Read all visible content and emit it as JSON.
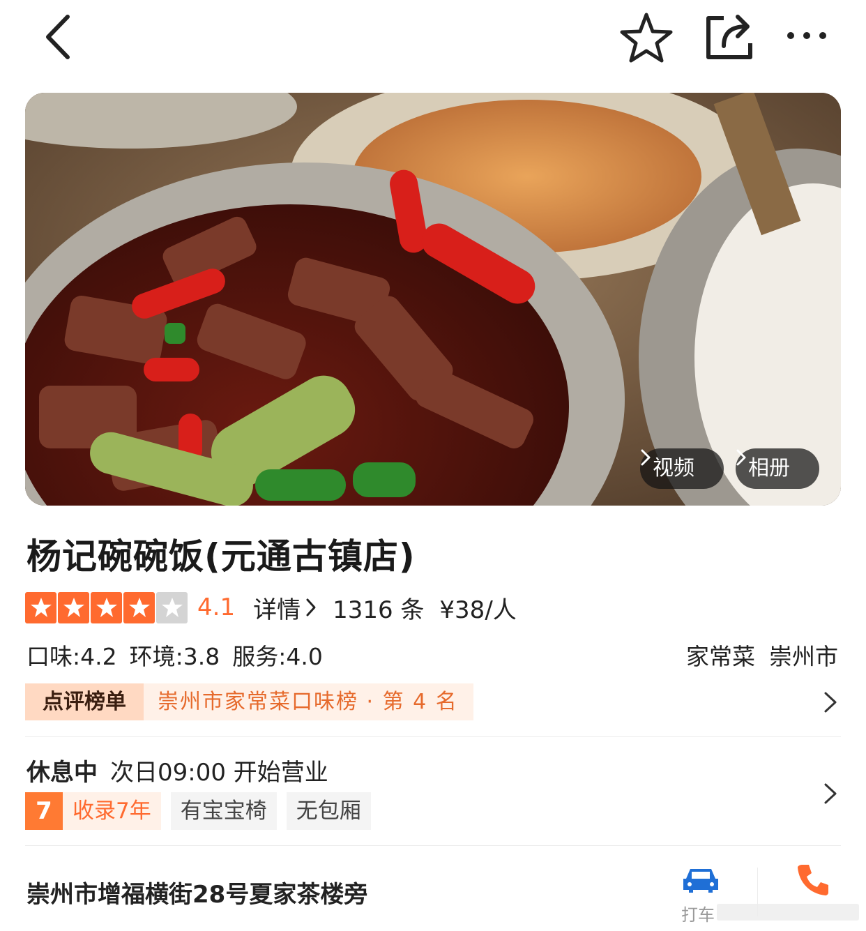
{
  "hero": {
    "video_label": "视频",
    "album_label": "相册"
  },
  "shop": {
    "name": "杨记碗碗饭(元通古镇店)",
    "rating": 4.1,
    "score_text": "4.1",
    "detail_label": "详情",
    "review_count": "1316 条",
    "price": "¥38/人",
    "sub_scores": {
      "taste": "口味:4.2",
      "environment": "环境:3.8",
      "service": "服务:4.0"
    },
    "category": "家常菜",
    "city": "崇州市"
  },
  "ranking": {
    "label": "点评榜单",
    "text": "崇州市家常菜口味榜 · 第 4 名"
  },
  "hours": {
    "status": "休息中",
    "next_open": "次日09:00 开始营业"
  },
  "tags": {
    "years_num": "7",
    "years_text": "收录7年",
    "baby_chair": "有宝宝椅",
    "no_room": "无包厢"
  },
  "location": {
    "address": "崇州市增福横街28号夏家茶楼旁",
    "taxi_label": "打车"
  },
  "colors": {
    "accent": "#ff6a2f",
    "rank_bg": "#fff1e8",
    "rank_label_bg": "#ffd9c2",
    "taxi_blue": "#1f6fd6"
  }
}
